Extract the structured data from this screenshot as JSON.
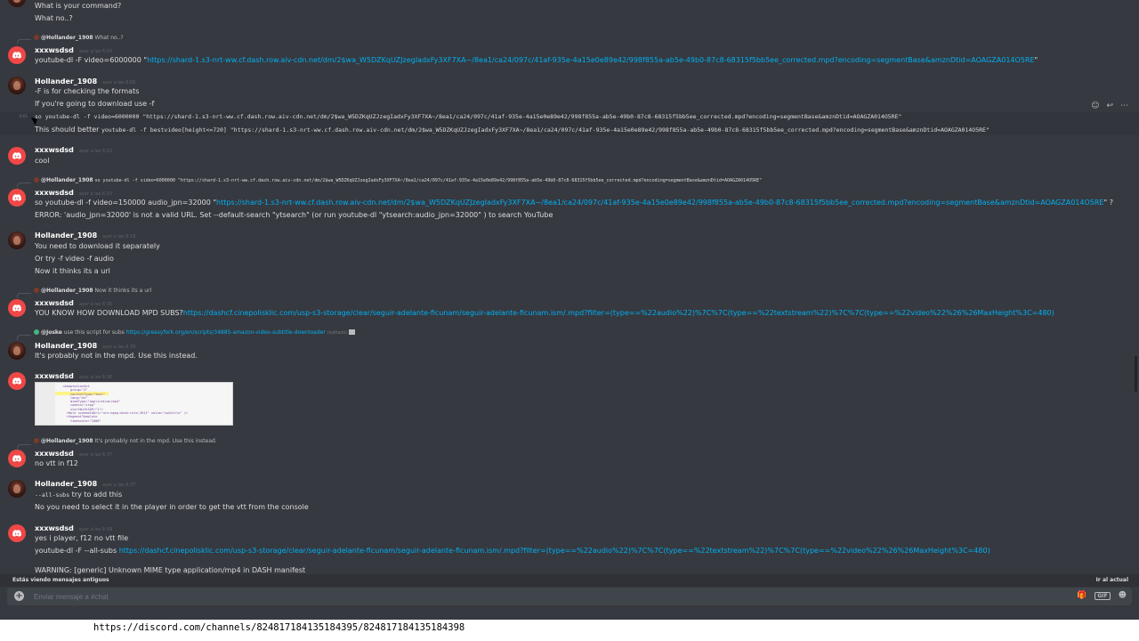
{
  "colors": {
    "background": "#36393f",
    "link": "#00b0f4",
    "author": "#ffffff",
    "avatar_red": "#f04747"
  },
  "top": {
    "line1": "What is your command?",
    "line2": "What no..?"
  },
  "m1": {
    "reply_name": "@Hollander_1908",
    "reply_text": "What no..?",
    "author": "xxxwsdsd",
    "ts": "ayer a las 6:00",
    "pre": "youtube-dl -F video=6000000 \"",
    "link": "https://shard-1.s3-nrt-ww.cf.dash.row.aiv-cdn.net/dm/2$wa_W5DZKqUZJzegIadxFy3XF7XA~/8ea1/ca24/097c/41af-935e-4a15e0e89e42/998f855a-ab5e-49b0-87c8-68315f5bb5ee_corrected.mpd?encoding=segmentBase&amznDtid=AOAGZA014O5RE",
    "post": "\""
  },
  "m2": {
    "author": "Hollander_1908",
    "ts": "ayer a las 6:00",
    "l1": "-F is for checking the formats",
    "l2": "If you're going to download use -f",
    "l3": "so youtube-dl -f video=6000000 \"https://shard-1.s3-nrt-ww.cf.dash.row.aiv-cdn.net/dm/2$wa_W5DZKqUZJzegIadxFy3XF7XA~/8ea1/ca24/097c/41af-935e-4a15e0e89e42/998f855a-ab5e-49b0-87c8-68315f5bb5ee_corrected.mpd?encoding=segmentBase&amznDtid=AOAGZA014O5RE\"",
    "l4_pre": "This should better",
    "l4_code": "youtube-dl -f bestvideo[height<=720] \"https://shard-1.s3-nrt-ww.cf.dash.row.aiv-cdn.net/dm/2$wa_W5DZKqUZJzegIadxFy3XF7XA~/8ea1/ca24/097c/41af-935e-4a15e0e89e42/998f855a-ab5e-49b0-87c8-68315f5bb5ee_corrected.mpd?encoding=segmentBase&amznDtid=AOAGZA014O5RE\""
  },
  "m3": {
    "author": "xxxwsdsd",
    "ts": "ayer a las 6:02",
    "text": "cool"
  },
  "m4": {
    "reply_name": "@Hollander_1908",
    "reply_text": "so youtube-dl -f video=6000000 \"https://shard-1.s3-nrt-ww.cf.dash.row.aiv-cdn.net/dm/2$wa_W5DZKqUZJzegIadxFy3XF7XA~/8ea1/ca24/097c/41af-935e-4a15e0e89e42/998f855a-ab5e-49b0-87c8-68315f5bb5ee_corrected.mpd?encoding=segmentBase&amznDtid=AOAGZA014O5RE\"",
    "author": "xxxwsdsd",
    "ts": "ayer a las 6:15",
    "pre": "so youtube-dl -f video=150000 audio_jpn=32000 \"",
    "link": "https://shard-1.s3-nrt-ww.cf.dash.row.aiv-cdn.net/dm/2$wa_W5DZKqUZJzegIadxFy3XF7XA~/8ea1/ca24/097c/41af-935e-4a15e0e89e42/998f855a-ab5e-49b0-87c8-68315f5bb5ee_corrected.mpd?encoding=segmentBase&amznDtid=AOAGZA014O5RE",
    "post": "\" ?",
    "error": "ERROR: 'audio_jpn=32000' is not a valid URL. Set --default-search \"ytsearch\" (or run  youtube-dl \"ytsearch:audio_jpn=32000\" ) to search YouTube"
  },
  "m5": {
    "author": "Hollander_1908",
    "ts": "ayer a las 6:19",
    "l1": "You need to download it separately",
    "l2": "Or try -f video -f audio",
    "l3": "Now it thinks its a url"
  },
  "m6": {
    "reply_name": "@Hollander_1908",
    "reply_text": "Now it thinks its a url",
    "author": "xxxwsdsd",
    "ts": "ayer a las 6:35",
    "pre": "YOU KNOW HOW DOWNLOAD MPD SUBS?",
    "link": "https://dashcf.cinepolisklic.com/usp-s3-storage/clear/seguir-adelante-ficunam/seguir-adelante-ficunam.ism/.mpd?filter=(type==%22audio%22)%7C%7C(type==%22textstream%22)%7C%7C(type==%22video%22%26%26MaxHeight%3C=480)"
  },
  "m7": {
    "reply_name": "@Joske",
    "reply_text": "use this script for subs",
    "reply_link": "https://greasyfork.org/en/scripts/34885-amazon-video-subtitle-downloader",
    "reply_edited": "(editado)",
    "author": "Hollander_1908",
    "ts": "ayer a las 6:36",
    "text": "It's probably not in the mpd. Use this instead."
  },
  "m8": {
    "author": "xxxwsdsd",
    "ts": "ayer a las 6:36",
    "image_code": "  <AdaptationSet\n      group=\"4\"\n      contentType=\"text\"\n      lang=\"es\"\n      mimeType=\"application/mp4\"\n      codecs=\"stpp\"\n      startWithSAP=\"1\">\n    <Role schemeIdUri=\"urn:mpeg:dash:role:2011\" value=\"subtitle\" />\n    <SegmentTemplate\n      timescale=\"1000\""
  },
  "m9": {
    "reply_name": "@Hollander_1908",
    "reply_text": "It's probably not in the mpd. Use this instead.",
    "author": "xxxwsdsd",
    "ts": "ayer a las 6:37",
    "text": "no vtt in f12"
  },
  "m10": {
    "author": "Hollander_1908",
    "ts": "ayer a las 6:37",
    "code": "--all-subs",
    "l1_post": " try to add this",
    "l2": "No you need to select it in the player in order to get the vtt from the console"
  },
  "m11": {
    "author": "xxxwsdsd",
    "ts": "ayer a las 6:39",
    "l1": "yes i player, f12 no vtt file",
    "l2_pre": "youtube-dl -F --all-subs ",
    "l2_link": "https://dashcf.cinepolisklic.com/usp-s3-storage/clear/seguir-adelante-ficunam/seguir-adelante-ficunam.ism/.mpd?filter=(type==%22audio%22)%7C%7C(type==%22textstream%22)%7C%7C(type==%22video%22%26%26MaxHeight%3C=480)",
    "l3": "WARNING: [generic] Unknown MIME type application/mp4 in DASH manifest"
  },
  "hover_side_ts": "6:01",
  "old_bar": {
    "left": "Estás viendo mensajes antiguos",
    "right": "Ir al actual"
  },
  "composer": {
    "placeholder": "Enviar mensaje a #chat",
    "gif": "GIF"
  },
  "icons": {
    "reaction": "add-reaction-icon",
    "reply": "reply-icon",
    "more": "more-icon",
    "gift": "gift-icon",
    "emoji": "emoji-icon"
  },
  "address_bar": {
    "url": "https://discord.com/channels/824817184135184395/824817184135184398"
  }
}
